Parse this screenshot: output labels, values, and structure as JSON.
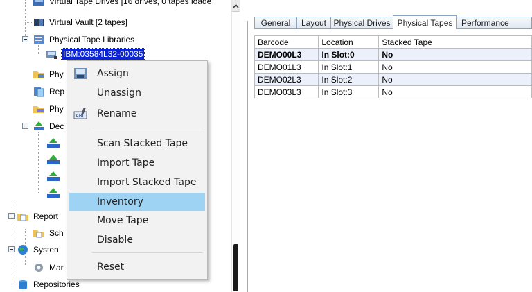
{
  "tree": {
    "items": [
      {
        "label": "Virtual Tape Drives [16 drives, 0 tapes loade",
        "icon": "tape-drives-icon"
      },
      {
        "label": "Virtual Vault [2 tapes]",
        "icon": "vault-icon"
      },
      {
        "label": "Physical Tape Libraries",
        "icon": "tape-library-icon"
      },
      {
        "label": "IBM:03584L32-00035",
        "icon": "library-device-icon"
      },
      {
        "label": "Phy",
        "icon": "folder-tapes-icon"
      },
      {
        "label": "Rep",
        "icon": "replication-icon"
      },
      {
        "label": "Phy",
        "icon": "folder-tapes-icon"
      },
      {
        "label": "Dec",
        "icon": "deduplication-icon"
      },
      {
        "label": "Report",
        "icon": "reports-folder-icon"
      },
      {
        "label": "Sch",
        "icon": "schedule-icon"
      },
      {
        "label": "Systen",
        "icon": "system-globe-icon"
      },
      {
        "label": "Mar",
        "icon": "maintenance-gear-icon"
      },
      {
        "label": "Repositories",
        "icon": "repository-icon"
      }
    ]
  },
  "context_menu": {
    "items": [
      {
        "label": "Assign",
        "icon": "assign-icon"
      },
      {
        "label": "Unassign"
      },
      {
        "label": "Rename",
        "icon": "rename-icon"
      },
      {
        "label": "Scan Stacked Tape"
      },
      {
        "label": "Import Tape"
      },
      {
        "label": "Import Stacked Tape"
      },
      {
        "label": "Inventory",
        "highlighted": true
      },
      {
        "label": "Move Tape"
      },
      {
        "label": "Disable"
      },
      {
        "label": "Reset"
      }
    ]
  },
  "tabs": [
    "General",
    "Layout",
    "Physical Drives",
    "Physical Tapes",
    "Performance"
  ],
  "active_tab": "Physical Tapes",
  "table": {
    "columns": [
      "Barcode",
      "Location",
      "Stacked Tape"
    ],
    "rows": [
      [
        "DEMO00L3",
        "In Slot:0",
        "No"
      ],
      [
        "DEMO01L3",
        "In Slot:1",
        "No"
      ],
      [
        "DEMO02L3",
        "In Slot:2",
        "No"
      ],
      [
        "DEMO03L3",
        "In Slot:3",
        "No"
      ]
    ]
  },
  "colors": {
    "selection": "#0a24d6",
    "menu_highlight": "#9fd3f3",
    "alt_row": "#ecf0fb",
    "tab_border": "#8ba3c2"
  }
}
